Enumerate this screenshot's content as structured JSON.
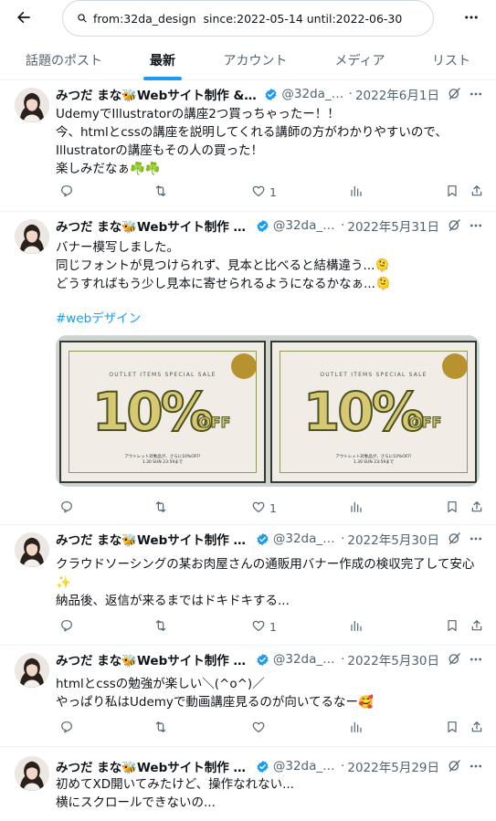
{
  "search": {
    "value": "from:32da_design  since:2022-05-14 until:2022-06-30"
  },
  "tabs": [
    {
      "label": "話題のポスト"
    },
    {
      "label": "最新"
    },
    {
      "label": "アカウント"
    },
    {
      "label": "メディア"
    },
    {
      "label": "リスト"
    }
  ],
  "tweets": [
    {
      "name": "みつだ まな🐝Webサイト制作 & 運...",
      "handle": "@32da_d...",
      "date": "2022年6月1日",
      "lines": [
        "UdemyでIllustratorの講座2つ買っちゃったー！！",
        "今、htmlとcssの講座を説明してくれる講師の方がわかりやすいので、",
        "Illustratorの講座もその人の買った！",
        "楽しみだなぁ☘️☘️"
      ],
      "likes": "1"
    },
    {
      "name": "みつだ まな🐝Webサイト制作 & ...",
      "handle": "@32da_d...",
      "date": "2022年5月31日",
      "lines": [
        "バナー模写しました。",
        "同じフォントが見つけられず、見本と比べると結構違う...🫠",
        "どうすればもう少し見本に寄せられるようになるかなぁ...🫠"
      ],
      "hashtag": "#webデザイン",
      "likes": "1",
      "media": {
        "sale_text": "OUTLET ITEMS SPECIAL SALE",
        "big_text": "10%",
        "off_text": "OFF",
        "sub_text": "アウトレット対象品が、さらに10%OFF!",
        "date_text": "1.30 SUN 23:59まで"
      }
    },
    {
      "name": "みつだ まな🐝Webサイト制作 & ...",
      "handle": "@32da_d...",
      "date": "2022年5月30日",
      "lines": [
        "クラウドソーシングの某お肉屋さんの通販用バナー作成の検収完了して安心",
        "✨",
        "納品後、返信が来るまではドキドキする..."
      ],
      "likes": "1"
    },
    {
      "name": "みつだ まな🐝Webサイト制作 & ...",
      "handle": "@32da_d...",
      "date": "2022年5月30日",
      "lines": [
        "htmlとcssの勉強が楽しい＼(^o^)／",
        "やっぱり私はUdemyで動画講座見るのが向いてるなー🥰"
      ],
      "likes": ""
    },
    {
      "name": "みつだ まな🐝Webサイト制作 & ...",
      "handle": "@32da_d...",
      "date": "2022年5月29日",
      "lines": [
        "初めてXD開いてみたけど、操作なれない...",
        "横にスクロールできないの..."
      ],
      "likes": ""
    }
  ],
  "icons": {
    "back": "arrow-left-icon",
    "search": "search-icon",
    "more": "more-dots-icon",
    "verified": "verified-badge-icon",
    "grok": "grok-icon",
    "reply": "reply-icon",
    "repost": "repost-icon",
    "like": "heart-icon",
    "views": "views-icon",
    "bookmark": "bookmark-icon",
    "share": "share-icon"
  },
  "colors": {
    "accent": "#1d9bf0",
    "text": "#0f1419",
    "muted": "#536471",
    "border": "#eff3f4"
  }
}
